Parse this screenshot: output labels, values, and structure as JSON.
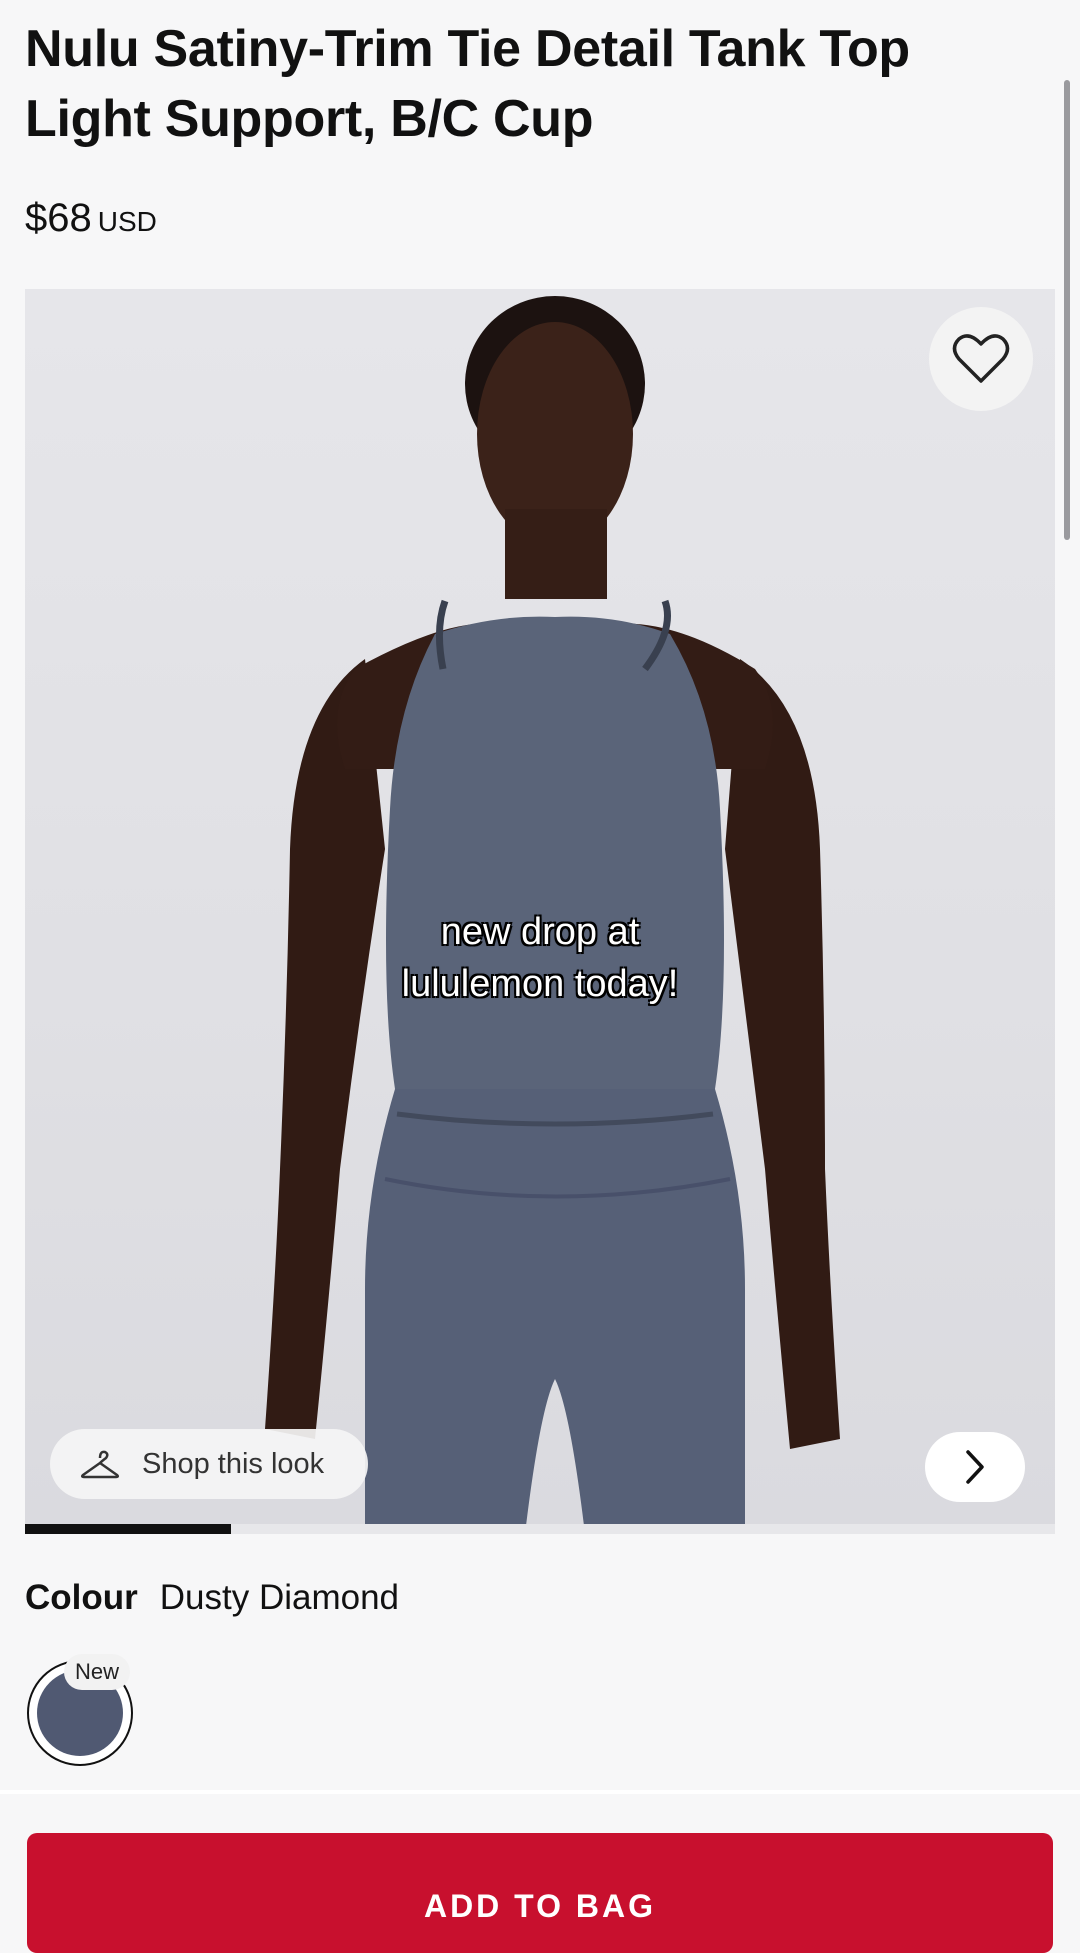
{
  "product": {
    "title": "Nulu Satiny-Trim Tie Detail Tank Top Light Support, B/C Cup",
    "price": "$68",
    "currency": "USD"
  },
  "gallery": {
    "shop_look_label": "Shop this look",
    "caption_line1": "new drop at",
    "caption_line2": "lululemon today!",
    "progress_fraction": 0.2
  },
  "colour": {
    "label": "Colour",
    "name": "Dusty Diamond",
    "swatch_hex": "#505972",
    "badge": "New"
  },
  "cta": {
    "add_to_bag": "ADD TO BAG",
    "color": "#c8102e"
  },
  "icons": [
    "heart-icon",
    "hanger-icon",
    "chevron-right-icon"
  ]
}
